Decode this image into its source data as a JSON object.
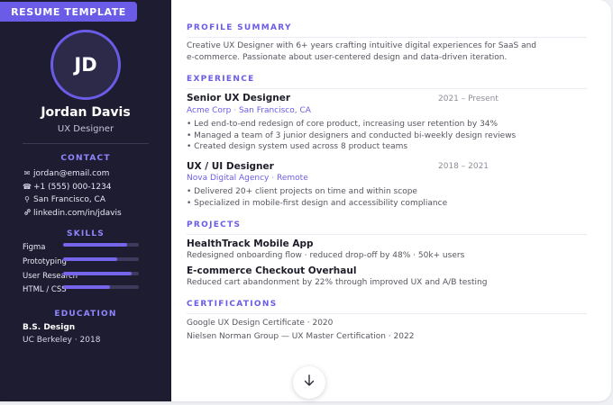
{
  "template_tag": "RESUME TEMPLATE",
  "profile": {
    "initials": "JD",
    "name": "Jordan Davis",
    "title": "UX Designer"
  },
  "sidebar": {
    "contact_heading": "CONTACT",
    "contact": [
      {
        "icon": "mail-icon",
        "glyph": "✉",
        "text": "jordan@email.com"
      },
      {
        "icon": "phone-icon",
        "glyph": "☎",
        "text": "+1 (555) 000-1234"
      },
      {
        "icon": "location-pin-icon",
        "glyph": "⚲",
        "text": "San Francisco, CA"
      },
      {
        "icon": "link-icon",
        "glyph": "🔗",
        "text": "linkedin.com/in/jdavis"
      }
    ],
    "skills_heading": "SKILLS",
    "skills": [
      {
        "label": "Figma",
        "level": 0.85
      },
      {
        "label": "Prototyping",
        "level": 0.72
      },
      {
        "label": "User Research",
        "level": 0.9
      },
      {
        "label": "HTML / CSS",
        "level": 0.62
      }
    ],
    "education_heading": "EDUCATION",
    "education": {
      "degree": "B.S. Design",
      "school": "UC Berkeley · 2018"
    }
  },
  "main": {
    "profile_summary": {
      "heading": "PROFILE SUMMARY",
      "lines": [
        "Creative UX Designer with 6+ years crafting intuitive digital experiences for SaaS and",
        "e-commerce. Passionate about user-centered design and data-driven iteration."
      ]
    },
    "experience": {
      "heading": "EXPERIENCE",
      "jobs": [
        {
          "title": "Senior UX Designer",
          "dates": "2021 – Present",
          "company": "Acme Corp",
          "location": "San Francisco, CA",
          "bullets": [
            "• Led end-to-end redesign of core product, increasing user retention by 34%",
            "• Managed a team of 3 junior designers and conducted bi-weekly design reviews",
            "• Created design system used across 8 product teams"
          ]
        },
        {
          "title": "UX / UI Designer",
          "dates": "2018 – 2021",
          "company": "Nova Digital Agency",
          "location": "Remote",
          "bullets": [
            "• Delivered 20+ client projects on time and within scope",
            "• Specialized in mobile-first design and accessibility compliance"
          ]
        }
      ]
    },
    "projects": {
      "heading": "PROJECTS",
      "items": [
        {
          "title": "HealthTrack Mobile App",
          "desc": "Redesigned onboarding flow · reduced drop-off by 48% · 50k+ users"
        },
        {
          "title": "E-commerce Checkout Overhaul",
          "desc": "Reduced cart abandonment by 22% through improved UX and A/B testing"
        }
      ]
    },
    "certifications": {
      "heading": "CERTIFICATIONS",
      "items": [
        "Google UX Design Certificate · 2020",
        "Nielsen Norman Group — UX Master Certification · 2022"
      ]
    }
  },
  "scroll_button": {
    "icon": "arrow-down-icon"
  },
  "colors": {
    "accent": "#6b5ce7",
    "sidebar_bg": "#1e1c30",
    "skill_fill": "#7565ea",
    "skill_track": "#3d3a5c"
  }
}
